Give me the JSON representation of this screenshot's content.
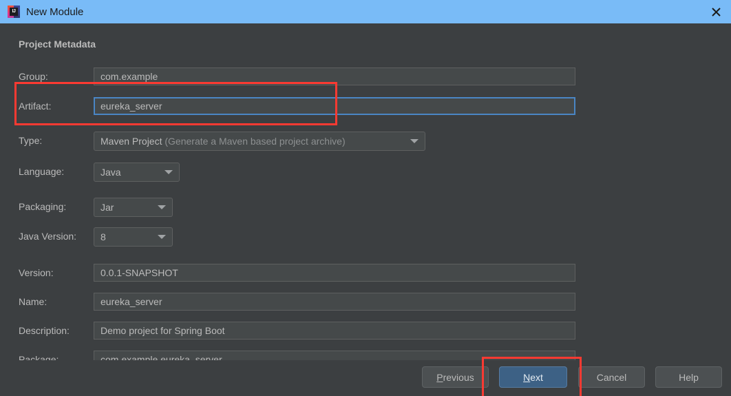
{
  "window": {
    "title": "New Module",
    "app_icon": "intellij-idea-icon",
    "icon_text": "IJ",
    "close_icon": "close-icon"
  },
  "section": {
    "title": "Project Metadata"
  },
  "fields": {
    "group": {
      "label": "Group:",
      "value": "com.example"
    },
    "artifact": {
      "label": "Artifact:",
      "value": "eureka_server",
      "focused": true
    },
    "type": {
      "label": "Type:",
      "value": "Maven Project",
      "value_hint": "(Generate a Maven based project archive)",
      "arrow_icon": "chevron-down-icon"
    },
    "language": {
      "label": "Language:",
      "value": "Java",
      "arrow_icon": "chevron-down-icon"
    },
    "packaging": {
      "label": "Packaging:",
      "value": "Jar",
      "arrow_icon": "chevron-down-icon"
    },
    "java_version": {
      "label": "Java Version:",
      "value": "8",
      "arrow_icon": "chevron-down-icon"
    },
    "version": {
      "label": "Version:",
      "value": "0.0.1-SNAPSHOT"
    },
    "name": {
      "label": "Name:",
      "value": "eureka_server"
    },
    "description": {
      "label": "Description:",
      "value": "Demo project for Spring Boot"
    },
    "package": {
      "label": "Package:",
      "value": "com.example.eureka_server"
    }
  },
  "buttons": {
    "previous": {
      "mnemonic": "P",
      "rest": "revious"
    },
    "next": {
      "mnemonic": "N",
      "rest": "ext",
      "is_default": true
    },
    "cancel": {
      "label": "Cancel"
    },
    "help": {
      "label": "Help"
    }
  },
  "annotations": {
    "artifact_highlight": "red-rectangle-artifact-row",
    "next_highlight": "red-rectangle-next-button"
  },
  "colors": {
    "titlebar": "#79bbf7",
    "dialog_background": "#3c3f41",
    "field_background": "#45494a",
    "focus_border": "#4a86c5",
    "default_button": "#3d6185",
    "annotation_red": "#fc3a32",
    "label_text": "#bbbbbb"
  }
}
